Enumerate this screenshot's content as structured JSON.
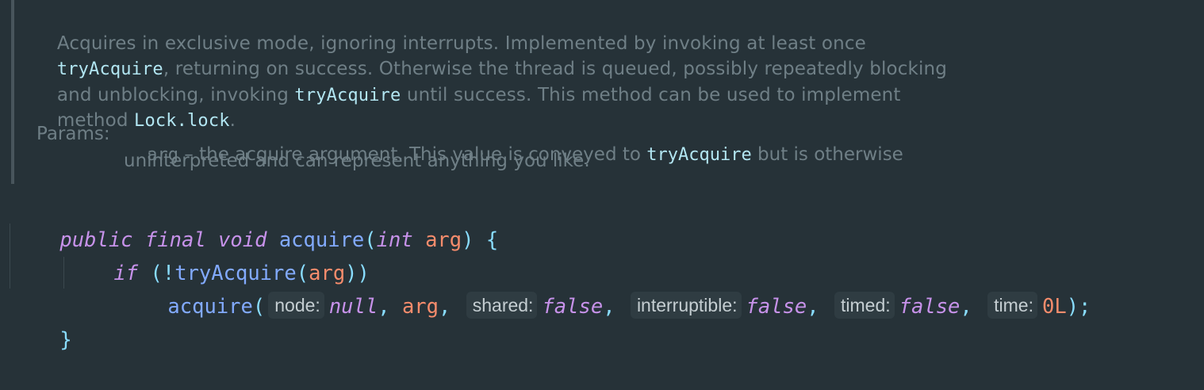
{
  "doc": {
    "line1": {
      "text": "Acquires in exclusive mode, ignoring interrupts. Implemented by invoking at least once"
    },
    "line2": {
      "code": "tryAcquire",
      "text": ", returning on success. Otherwise the thread is queued, possibly repeatedly blocking"
    },
    "line3": {
      "pre": "and unblocking, invoking ",
      "code": "tryAcquire",
      "post": " until success. This method can be used to implement"
    },
    "line4": {
      "pre": "method ",
      "code": "Lock.lock",
      "post": "."
    },
    "params_label": "Params:",
    "param1": {
      "name": "arg",
      "pre": " – the acquire argument. This value is conveyed to ",
      "code": "tryAcquire",
      "post": " but is otherwise"
    },
    "param2": "uninterpreted and can represent anything you like."
  },
  "code": {
    "line1": {
      "public": "public",
      "final": "final",
      "void": "void",
      "name": "acquire",
      "open": "(",
      "int": "int",
      "param": "arg",
      "close": ")",
      "brace": "{"
    },
    "line2": {
      "if": "if",
      "open": "(!",
      "call": "tryAcquire",
      "popen": "(",
      "arg": "arg",
      "pclose": "))"
    },
    "line3": {
      "call": "acquire",
      "open": "(",
      "hint_node": "node:",
      "val_node": "null",
      "comma1": ",",
      "arg": "arg",
      "comma2": ",",
      "hint_shared": "shared:",
      "val_shared": "false",
      "comma3": ",",
      "hint_interruptible": "interruptible:",
      "val_interruptible": "false",
      "comma4": ",",
      "hint_timed": "timed:",
      "val_timed": "false",
      "comma5": ",",
      "hint_time": "time:",
      "val_time": "0L",
      "close": ");"
    },
    "line4": {
      "brace": "}"
    }
  }
}
